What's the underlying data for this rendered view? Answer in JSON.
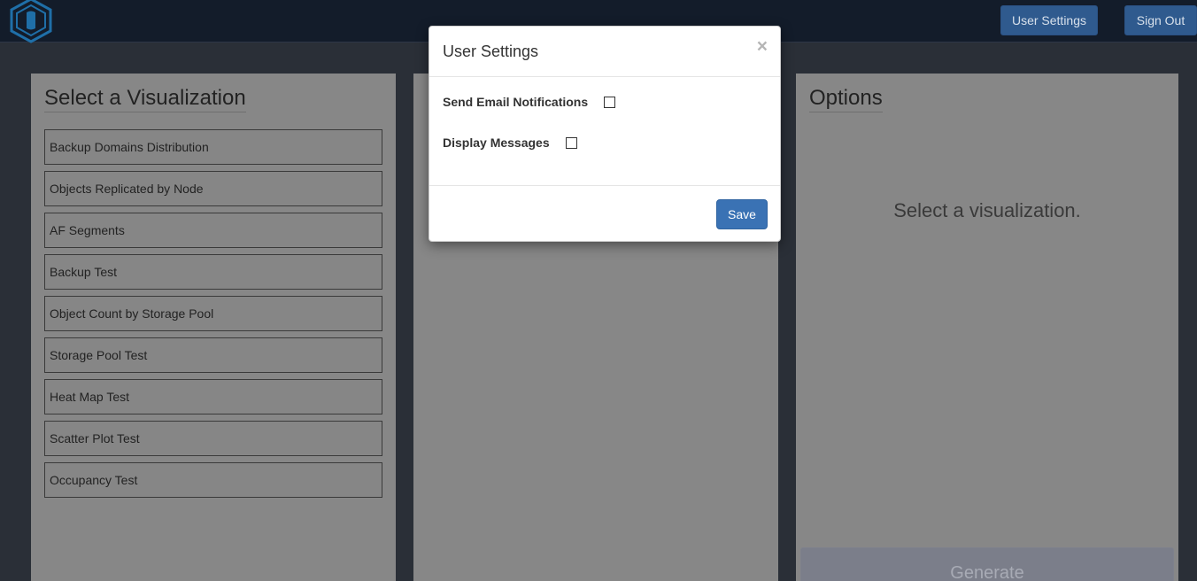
{
  "navbar": {
    "user_settings_label": "User Settings",
    "sign_out_label": "Sign Out",
    "logo_icon": "hexagon-shield-logo"
  },
  "left_panel": {
    "title": "Select a Visualization",
    "items": [
      "Backup Domains Distribution",
      "Objects Replicated by Node",
      "AF Segments",
      "Backup Test",
      "Object Count by Storage Pool",
      "Storage Pool Test",
      "Heat Map Test",
      "Scatter Plot Test",
      "Occupancy Test"
    ]
  },
  "right_panel": {
    "title": "Options",
    "placeholder": "Select a visualization.",
    "generate_label": "Generate"
  },
  "modal": {
    "title": "User Settings",
    "close_glyph": "×",
    "settings": [
      {
        "label": "Send Email Notifications",
        "checked": false
      },
      {
        "label": "Display Messages",
        "checked": false
      }
    ],
    "save_label": "Save"
  },
  "colors": {
    "navbar_bg": "#131c2a",
    "page_bg": "#2a2f37",
    "primary_button": "#3a72b4",
    "panel_dimmed": "#878787"
  }
}
